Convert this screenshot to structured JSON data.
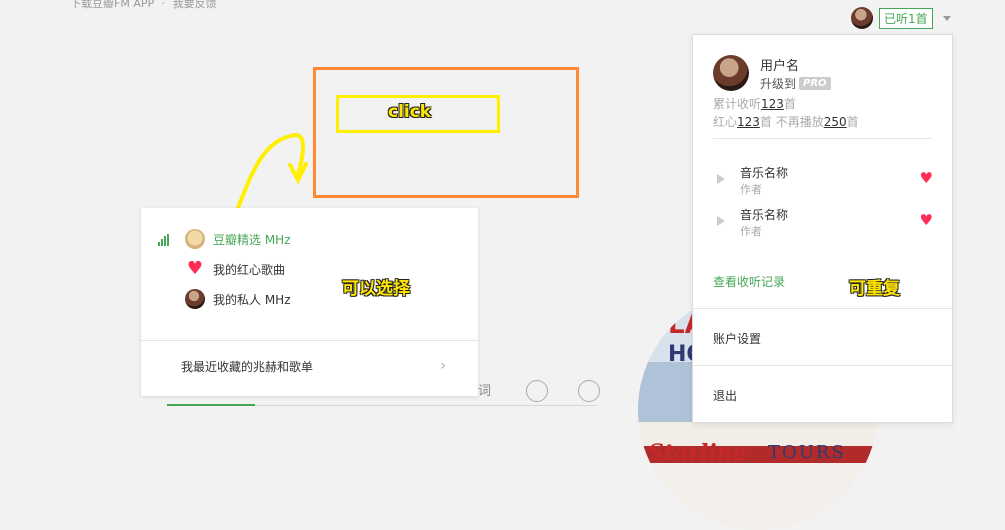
{
  "top_nav": {
    "download_app": "下载豆瓣FM APP",
    "separator": "·",
    "feedback": "我要反馈"
  },
  "user_chip": {
    "listened_badge": "已听1首"
  },
  "annotations": {
    "click": "click",
    "can_select": "可以选择",
    "repeatable": "可重复"
  },
  "channel_panel": {
    "items": [
      {
        "label": "豆瓣精选 MHz",
        "icon": "douban-bean-icon",
        "active": true
      },
      {
        "label": "我的红心歌曲",
        "icon": "heart-icon",
        "active": false
      },
      {
        "label": "我的私人 MHz",
        "icon": "personal-avatar-icon",
        "active": false
      }
    ],
    "favorites_link": "我最近收藏的兆赫和歌单",
    "chevron": "›"
  },
  "player": {
    "lyrics_icon_text": "词"
  },
  "album_art": {
    "line1": "LA",
    "line2": "HO",
    "brand": "Starline",
    "tours": "TOURS"
  },
  "dropdown": {
    "username": "用户名",
    "upgrade_label": "升级到",
    "pro_badge": "PRO",
    "total_prefix": "累计收听",
    "total_count": "123",
    "total_suffix": "首",
    "hearts_prefix": "红心",
    "hearts_count": "123",
    "hearts_suffix": "首 不再播放",
    "skip_count": "250",
    "skip_suffix": "首",
    "tracks": [
      {
        "name": "音乐名称",
        "artist": "作者"
      },
      {
        "name": "音乐名称",
        "artist": "作者"
      }
    ],
    "history_link": "查看收听记录",
    "account_settings": "账户设置",
    "logout": "退出"
  },
  "colors": {
    "accent_green": "#46a756",
    "heart_red": "#ff2d55",
    "annot_orange": "#ff8a33",
    "annot_yellow": "#ffef00"
  }
}
